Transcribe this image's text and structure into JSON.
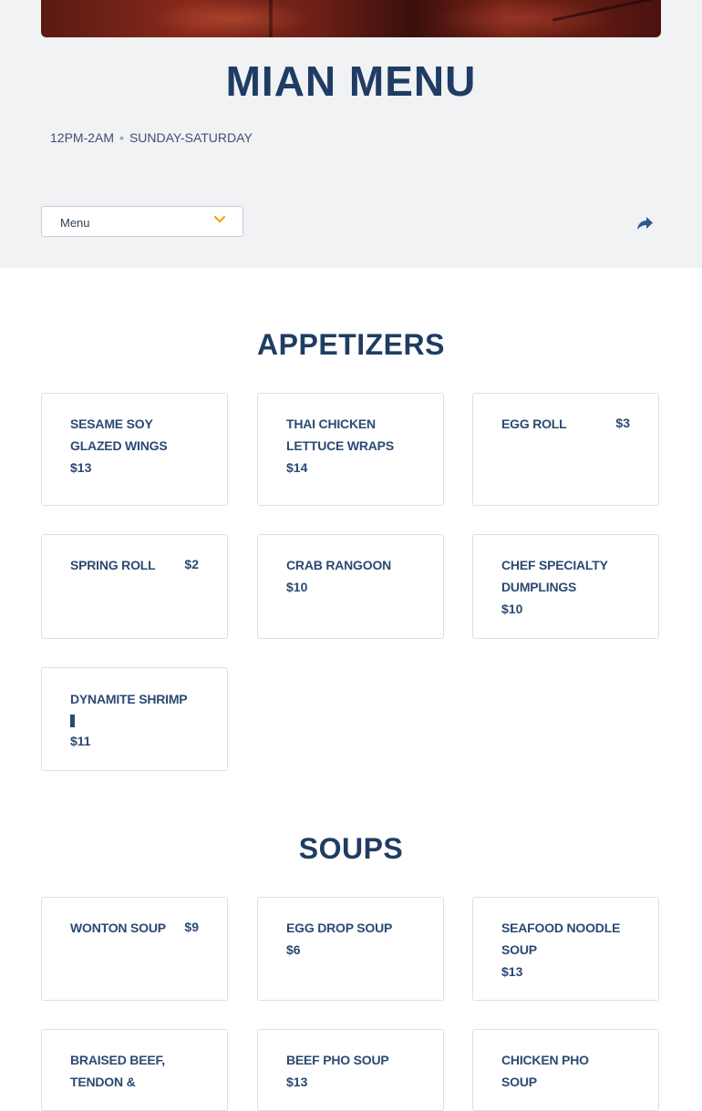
{
  "header": {
    "title": "MIAN MENU",
    "hours": "12PM-2AM",
    "days": "SUNDAY-SATURDAY",
    "separator": "•"
  },
  "menu_select": {
    "label": "Menu",
    "chevron_color": "#f0a500"
  },
  "icons": {
    "share": "share-arrow-icon",
    "chevron": "chevron-down-icon"
  },
  "sections": [
    {
      "title": "APPETIZERS",
      "items": [
        {
          "name": "SESAME SOY GLAZED WINGS",
          "price": "$13"
        },
        {
          "name": "THAI CHICKEN LETTUCE WRAPS",
          "price": "$14"
        },
        {
          "name": "EGG ROLL",
          "price": "$3"
        },
        {
          "name": "SPRING ROLL",
          "price": "$2"
        },
        {
          "name": "CRAB RANGOON",
          "price": "$10"
        },
        {
          "name": "CHEF SPECIALTY DUMPLINGS",
          "price": "$10"
        },
        {
          "name": "DYNAMITE SHRIMP",
          "price": "$11"
        }
      ]
    },
    {
      "title": "SOUPS",
      "items": [
        {
          "name": "WONTON SOUP",
          "price": "$9"
        },
        {
          "name": "EGG DROP SOUP",
          "price": "$6"
        },
        {
          "name": "SEAFOOD NOODLE SOUP",
          "price": "$13"
        },
        {
          "name": "BRAISED BEEF, TENDON &",
          "price": ""
        },
        {
          "name": "BEEF PHO SOUP",
          "price": "$13"
        },
        {
          "name": "CHICKEN PHO SOUP",
          "price": ""
        }
      ]
    }
  ],
  "colors": {
    "primary": "#1f3c63",
    "item_text": "#2b4a73",
    "band_bg": "#f0f2f4",
    "accent": "#f0a500"
  }
}
